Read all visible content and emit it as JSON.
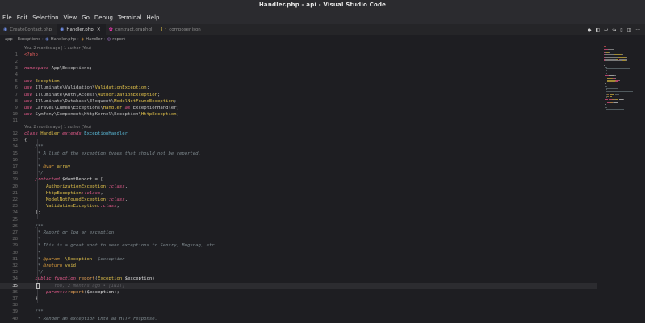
{
  "window": {
    "title": "Handler.php - api - Visual Studio Code"
  },
  "menu": [
    "File",
    "Edit",
    "Selection",
    "View",
    "Go",
    "Debug",
    "Terminal",
    "Help"
  ],
  "tabs": [
    {
      "label": "CreateContact.php",
      "icon": "php-file-icon",
      "active": false
    },
    {
      "label": "Handler.php",
      "icon": "php-file-icon",
      "active": true,
      "close": "×"
    },
    {
      "label": "contract.graphql",
      "icon": "graphql-file-icon",
      "active": false
    },
    {
      "label": "composer.json",
      "icon": "json-file-icon",
      "active": false
    }
  ],
  "editor_actions": [
    "◆",
    "◧",
    "↩",
    "↪",
    "▯",
    "◫",
    "···"
  ],
  "breadcrumb": [
    "app",
    "Exceptions",
    "Handler.php",
    "Handler",
    "report"
  ],
  "codelens": [
    {
      "before_line": 1,
      "text": "You, 2 months ago | 1 author (You)"
    },
    {
      "before_line": 12,
      "text": "You, 2 months ago | 1 author (You)"
    }
  ],
  "current_line": 35,
  "blame": "You, 2 months ago • [INIT]",
  "lines": [
    [
      [
        "tag",
        "<?php"
      ]
    ],
    [],
    [
      [
        "kw",
        "namespace"
      ],
      [
        "ns",
        " App\\Exceptions;"
      ]
    ],
    [],
    [
      [
        "kw",
        "use"
      ],
      [
        "ns",
        " "
      ],
      [
        "cls",
        "Exception"
      ],
      [
        "pn",
        ";"
      ]
    ],
    [
      [
        "kw",
        "use"
      ],
      [
        "ns",
        " Illuminate\\Validation\\"
      ],
      [
        "cls",
        "ValidationException"
      ],
      [
        "pn",
        ";"
      ]
    ],
    [
      [
        "kw",
        "use"
      ],
      [
        "ns",
        " Illuminate\\Auth\\Access\\"
      ],
      [
        "cls",
        "AuthorizationException"
      ],
      [
        "pn",
        ";"
      ]
    ],
    [
      [
        "kw",
        "use"
      ],
      [
        "ns",
        " Illuminate\\Database\\Eloquent\\"
      ],
      [
        "cls",
        "ModelNotFoundException"
      ],
      [
        "pn",
        ";"
      ]
    ],
    [
      [
        "kw",
        "use"
      ],
      [
        "ns",
        " Laravel\\Lumen\\Exceptions\\"
      ],
      [
        "cls",
        "Handler"
      ],
      [
        "kw",
        " as"
      ],
      [
        "ns",
        " ExceptionHandler;"
      ]
    ],
    [
      [
        "kw",
        "use"
      ],
      [
        "ns",
        " Symfony\\Component\\HttpKernel\\Exception\\"
      ],
      [
        "cls",
        "HttpException"
      ],
      [
        "pn",
        ";"
      ]
    ],
    [],
    [
      [
        "kw",
        "class"
      ],
      [
        "cls",
        " Handler"
      ],
      [
        "kw",
        " extends"
      ],
      [
        "cls2",
        " ExceptionHandler"
      ]
    ],
    [
      [
        "pn",
        "{"
      ]
    ],
    [
      [
        "cm",
        "    /**"
      ]
    ],
    [
      [
        "cm",
        "     * A list of the exception types that should not be reported."
      ]
    ],
    [
      [
        "cm",
        "     *"
      ]
    ],
    [
      [
        "cm",
        "     * "
      ],
      [
        "ta",
        "@var"
      ],
      [
        "cm",
        " "
      ],
      [
        "cls",
        "array"
      ]
    ],
    [
      [
        "cm",
        "     */"
      ]
    ],
    [
      [
        "kw",
        "    protected"
      ],
      [
        "var",
        " $dontReport"
      ],
      [
        "pn",
        " = ["
      ]
    ],
    [
      [
        "cls",
        "        AuthorizationException"
      ],
      [
        "kw",
        "::class"
      ],
      [
        "pn",
        ","
      ]
    ],
    [
      [
        "cls",
        "        HttpException"
      ],
      [
        "kw",
        "::class"
      ],
      [
        "pn",
        ","
      ]
    ],
    [
      [
        "cls",
        "        ModelNotFoundException"
      ],
      [
        "kw",
        "::class"
      ],
      [
        "pn",
        ","
      ]
    ],
    [
      [
        "cls",
        "        ValidationException"
      ],
      [
        "kw",
        "::class"
      ],
      [
        "pn",
        ","
      ]
    ],
    [
      [
        "pn",
        "    ];"
      ]
    ],
    [],
    [
      [
        "cm",
        "    /**"
      ]
    ],
    [
      [
        "cm",
        "     * Report or log an exception."
      ]
    ],
    [
      [
        "cm",
        "     *"
      ]
    ],
    [
      [
        "cm",
        "     * This is a great spot to send exceptions to Sentry, Bugsnag, etc."
      ]
    ],
    [
      [
        "cm",
        "     *"
      ]
    ],
    [
      [
        "cm",
        "     * "
      ],
      [
        "ta",
        "@param"
      ],
      [
        "cm",
        "  "
      ],
      [
        "cls",
        "\\Exception"
      ],
      [
        "cm",
        "  $exception"
      ]
    ],
    [
      [
        "cm",
        "     * "
      ],
      [
        "ta",
        "@return"
      ],
      [
        "cm",
        " "
      ],
      [
        "cls",
        "void"
      ]
    ],
    [
      [
        "cm",
        "     */"
      ]
    ],
    [
      [
        "kw",
        "    public"
      ],
      [
        "kw",
        " function"
      ],
      [
        "fn",
        " report"
      ],
      [
        "pn",
        "("
      ],
      [
        "cls",
        "Exception"
      ],
      [
        "var",
        " $exception"
      ],
      [
        "pn",
        ")"
      ]
    ],
    [
      [
        "pn",
        "    {"
      ]
    ],
    [
      [
        "kw",
        "        parent"
      ],
      [
        "kw",
        "::"
      ],
      [
        "fn",
        "report"
      ],
      [
        "pn",
        "("
      ],
      [
        "var",
        "$exception"
      ],
      [
        "pn",
        ");"
      ]
    ],
    [
      [
        "pn",
        "    }"
      ]
    ],
    [],
    [
      [
        "cm",
        "    /**"
      ]
    ],
    [
      [
        "cm",
        "     * Render an exception into an HTTP response."
      ]
    ]
  ]
}
